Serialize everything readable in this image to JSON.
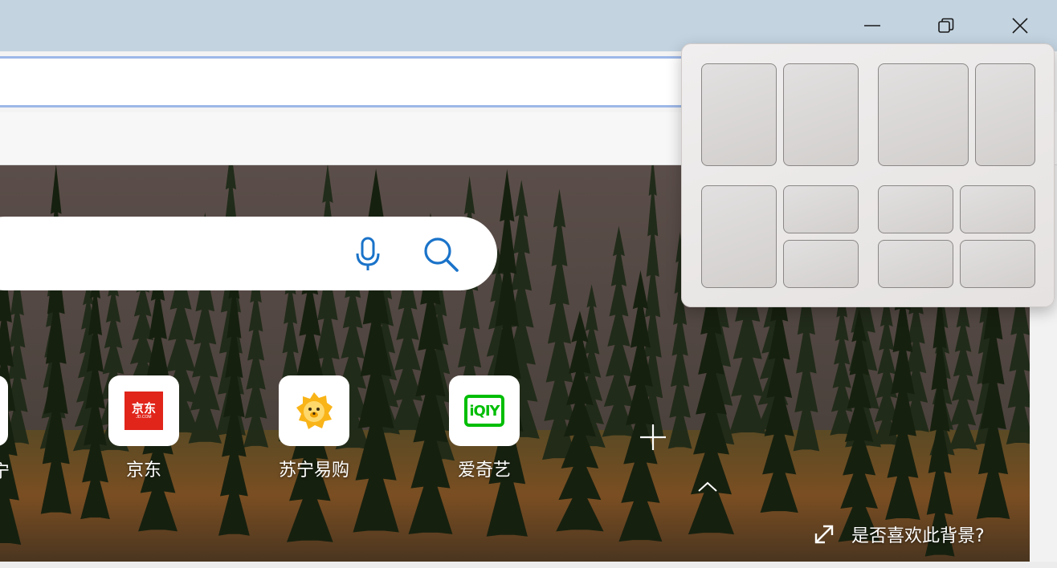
{
  "window_controls": {
    "minimize_icon": "minimize-icon",
    "restore_icon": "restore-icon",
    "close_icon": "close-icon"
  },
  "search": {
    "mic_icon": "microphone-icon",
    "search_icon": "search-icon",
    "accent_color": "#1a73c9"
  },
  "quick_links": [
    {
      "label": "京东",
      "icon_text": "京东",
      "icon_subtext": "JD.COM",
      "icon_color": "#e1251b"
    },
    {
      "label": "苏宁易购",
      "icon": "suning-lion-icon",
      "icon_color": "#f9b418"
    },
    {
      "label": "爱奇艺",
      "icon_text": "iQIY",
      "icon_color": "#00be06"
    }
  ],
  "partial_link_label": "宁",
  "add_link_icon": "plus-icon",
  "background_feedback": {
    "label": "是否喜欢此背景?",
    "icon": "expand-icon"
  },
  "snap_layouts": {
    "layouts": [
      "two-equal-columns",
      "wide-left-narrow-right",
      "one-left-two-right-stacked",
      "four-quadrants"
    ]
  }
}
